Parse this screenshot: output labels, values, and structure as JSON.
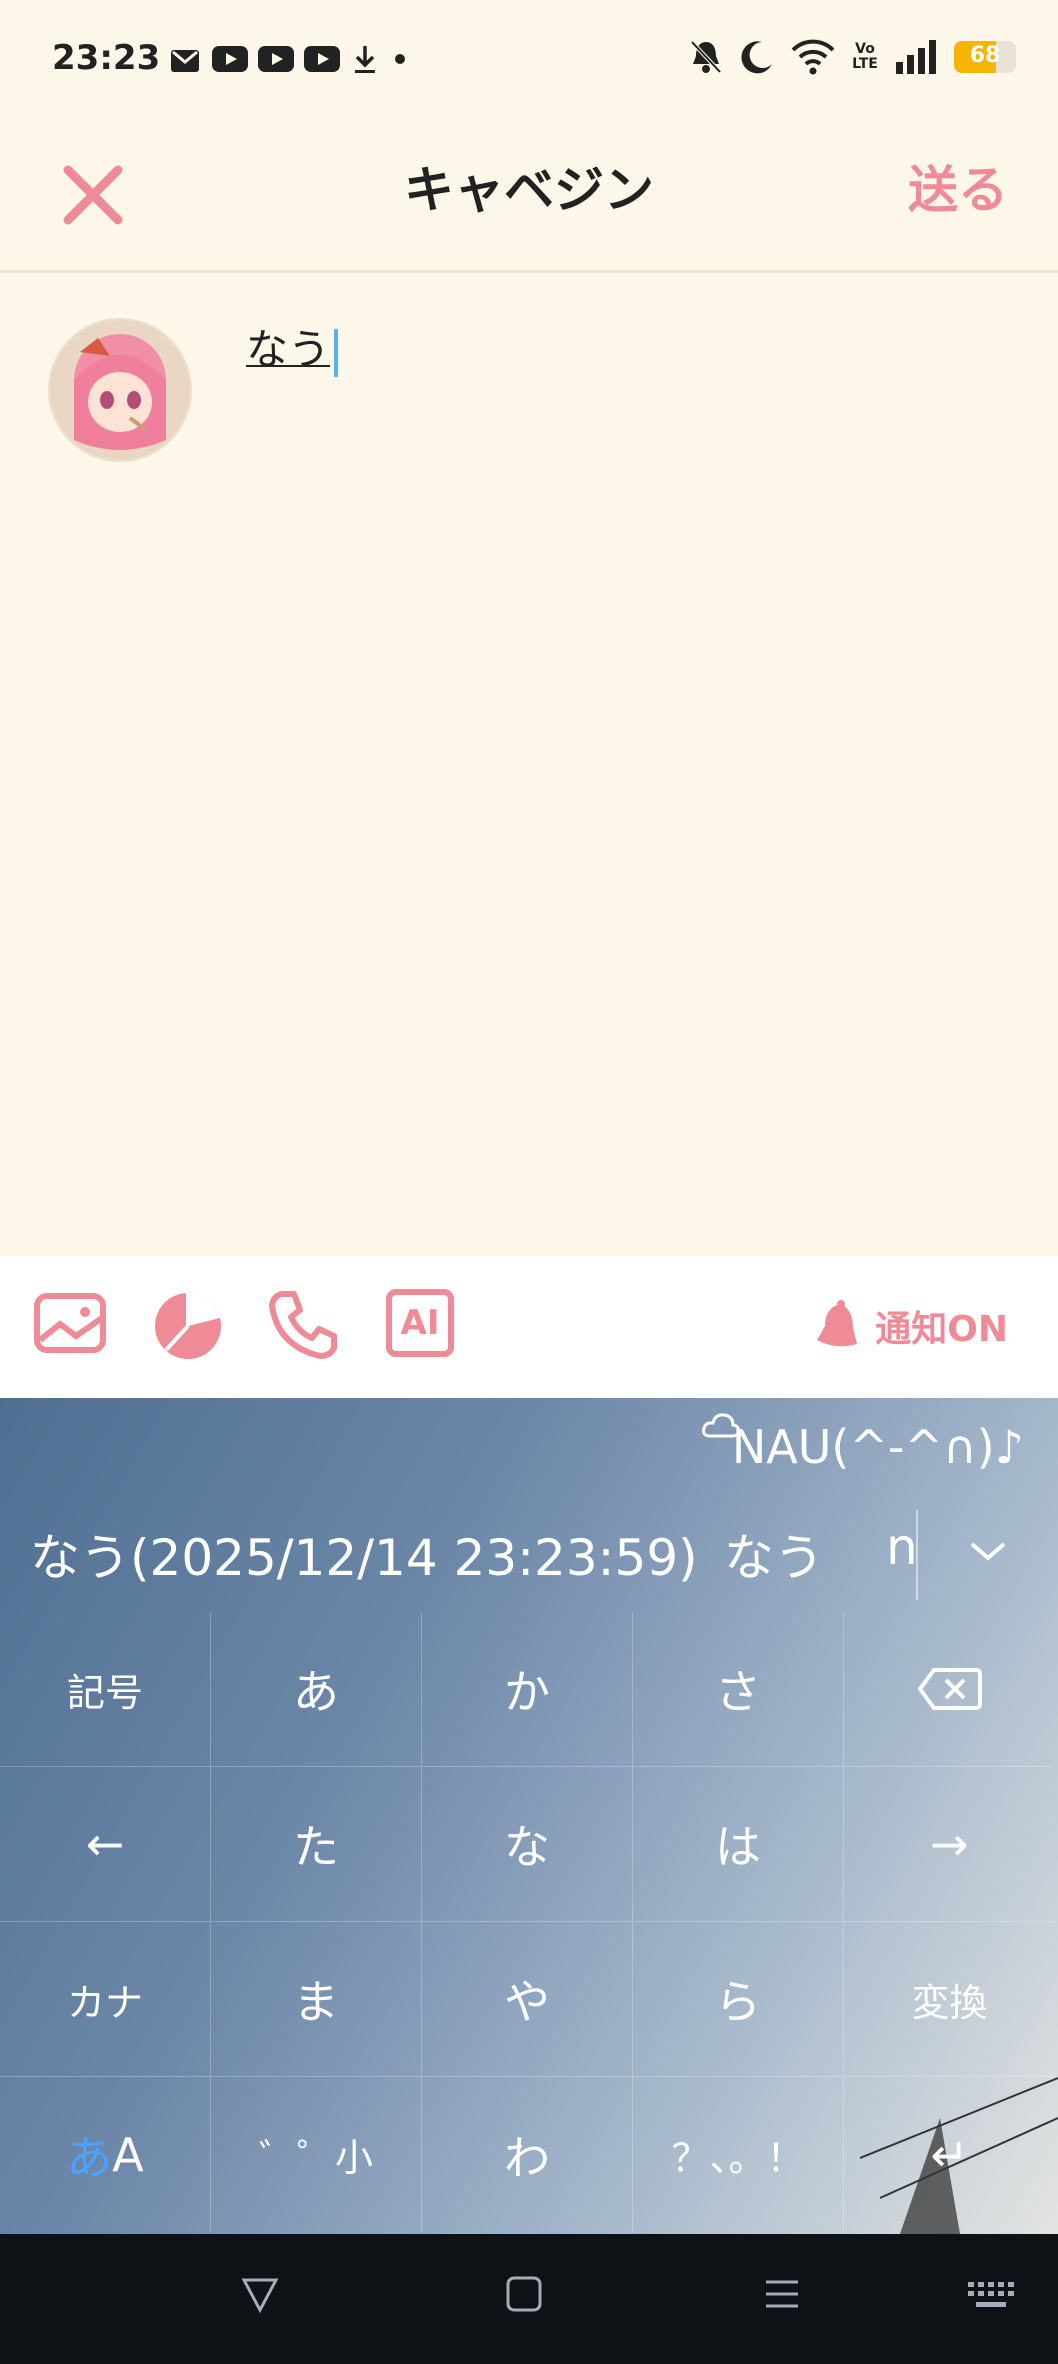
{
  "status_bar": {
    "time": "23:23",
    "battery": "68",
    "battery_level_percent": 68,
    "left_icons": [
      "mail-icon",
      "youtube-icon",
      "youtube-icon",
      "youtube-icon",
      "download-icon",
      "dot-icon"
    ],
    "right_icons": [
      "bell-off-icon",
      "moon-icon",
      "wifi-icon",
      "volte-icon",
      "signal-icon",
      "battery-icon"
    ],
    "volte_label": "Vo LTE"
  },
  "header": {
    "title": "キャベジン",
    "send_label": "送る"
  },
  "composer": {
    "text": "なう"
  },
  "toolbar": {
    "icons": [
      "image-icon",
      "pie-chart-icon",
      "phone-icon",
      "ai-icon"
    ],
    "ai_label": "AI",
    "notify_label": "通知ON"
  },
  "keyboard": {
    "kaomoji": "NAU(^-^∩)♪",
    "candidates": [
      "なう(2025/12/14 23:23:59)",
      "なう",
      "n"
    ],
    "keys": [
      [
        "記号",
        "あ",
        "か",
        "さ",
        "⌫"
      ],
      [
        "←",
        "た",
        "な",
        "は",
        "→"
      ],
      [
        "カナ",
        "ま",
        "や",
        "ら",
        "変換"
      ],
      [
        "あA",
        "゛゜小",
        "わ",
        "？、。！",
        "↵"
      ]
    ],
    "mode_label_a": "あ",
    "mode_label_b": "A"
  },
  "colors": {
    "accent": "#ef8a97",
    "background": "#fdf7e9",
    "caret": "#5bb1ee"
  }
}
